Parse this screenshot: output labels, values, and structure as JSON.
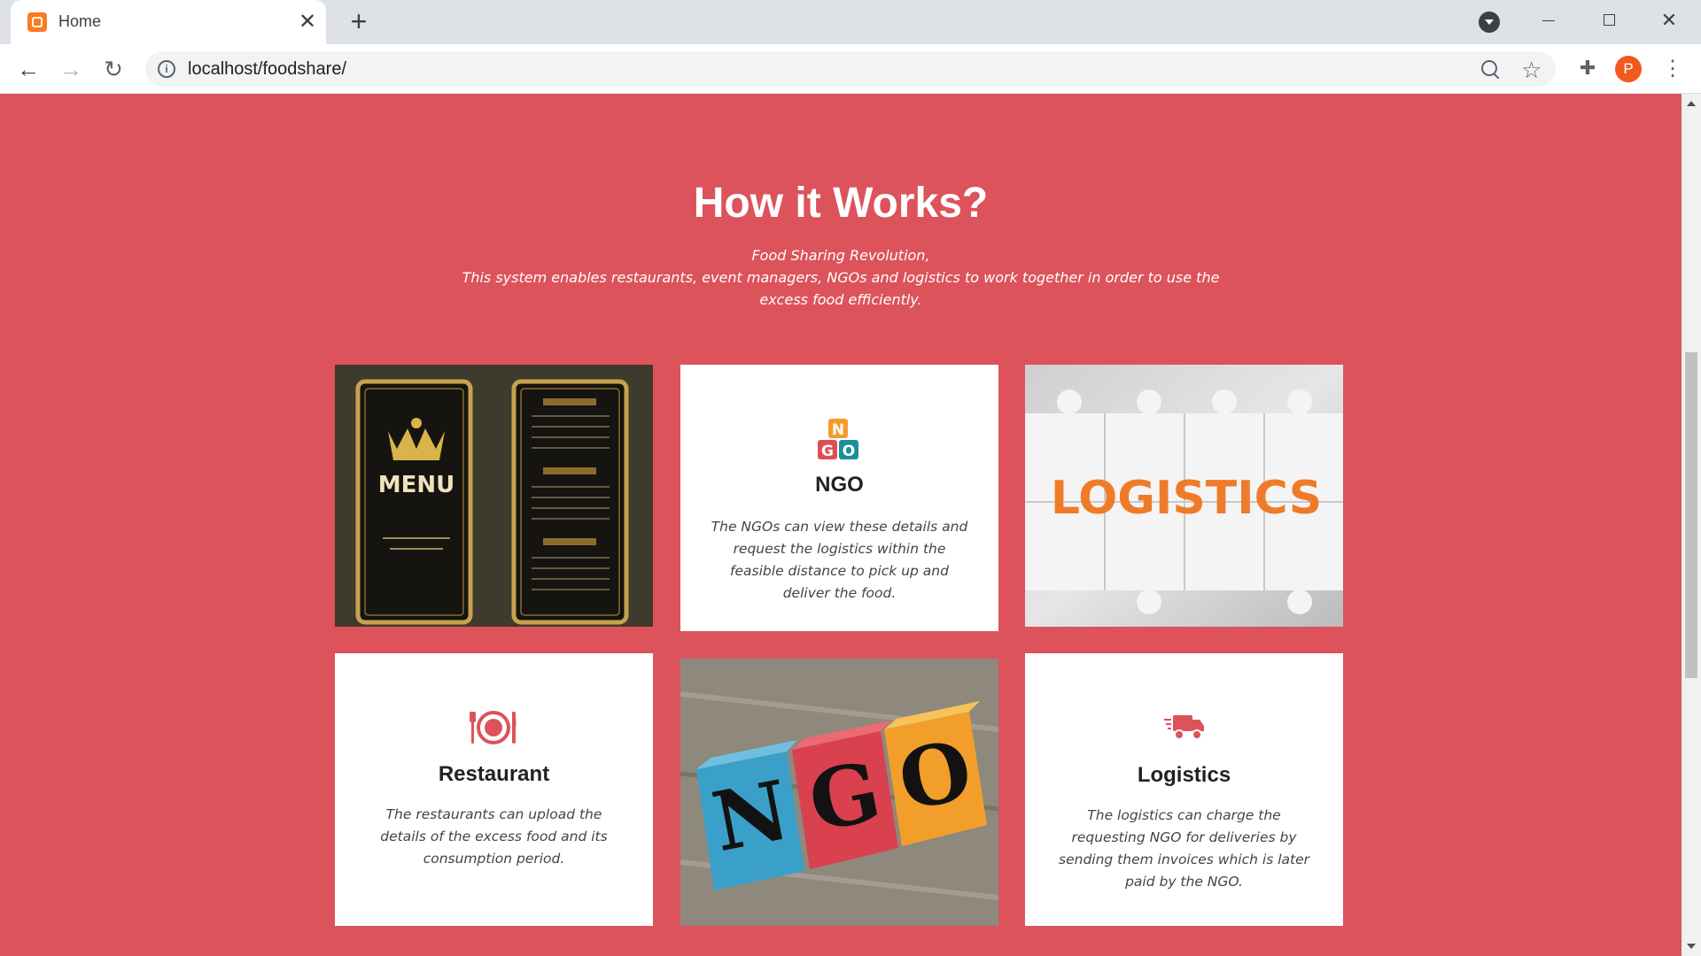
{
  "browser": {
    "tab_title": "Home",
    "url": "localhost/foodshare/",
    "profile_initial": "P"
  },
  "colors": {
    "page_background": "#dc535b",
    "card_background": "#ffffff",
    "accent_icon": "#dc535b"
  },
  "section": {
    "title": "How it Works?",
    "intro_line1": "Food Sharing Revolution,",
    "intro_line2": "This system enables restaurants, event managers, NGOs and logistics to work together in order to use the excess food efficiently."
  },
  "cards": {
    "menu_image": {
      "label": "MENU",
      "icon": "menu-card-image"
    },
    "ngo": {
      "icon": "ngo-blocks-icon",
      "icon_letters": [
        "N",
        "G",
        "O"
      ],
      "title": "NGO",
      "text": "The NGOs can view these details and request the logistics within the feasible distance to pick up and deliver the food."
    },
    "logistics_image": {
      "label": "LOGISTICS",
      "icon": "puzzle-image"
    },
    "restaurant": {
      "icon": "plate-cutlery-icon",
      "title": "Restaurant",
      "text": "The restaurants can upload the details of the excess food and its consumption period."
    },
    "ngo_image": {
      "letters": [
        "N",
        "G",
        "O"
      ],
      "icon": "ngo-wooden-blocks-image"
    },
    "logistics": {
      "icon": "delivery-truck-icon",
      "title": "Logistics",
      "text": "The logistics can charge the requesting NGO for deliveries by sending them invoices which is later paid by the NGO."
    }
  }
}
